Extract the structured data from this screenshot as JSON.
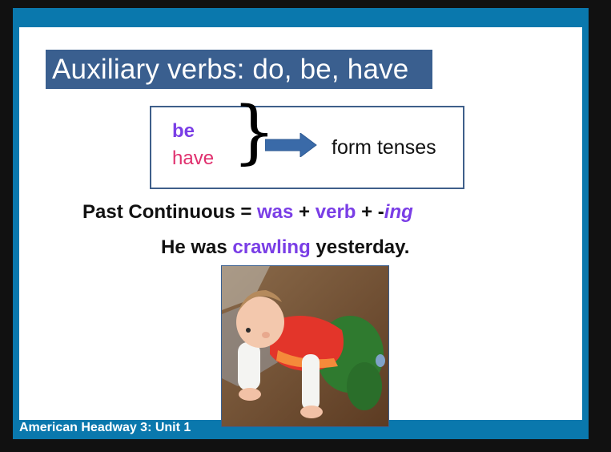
{
  "slide": {
    "title": "Auxiliary verbs:  do, be, have",
    "rule_box": {
      "aux_be": "be",
      "aux_have": "have",
      "result": "form tenses"
    },
    "formula": {
      "label": "Past Continuous = ",
      "aux": "was",
      "plus1": " + ",
      "verb": "verb",
      "plus2": " + -",
      "suffix": "ing"
    },
    "example": {
      "before": "He was ",
      "highlight": "crawling",
      "after": " yesterday."
    },
    "photo_subject": "baby crawling"
  },
  "footer": {
    "text": "American Headway 3:   Unit 1"
  },
  "colors": {
    "frame": "#0a78ad",
    "title_bg": "#3a5f8f",
    "highlight_purple": "#7a3ee6",
    "have_pink": "#e0306e",
    "arrow": "#3a6aa8"
  }
}
